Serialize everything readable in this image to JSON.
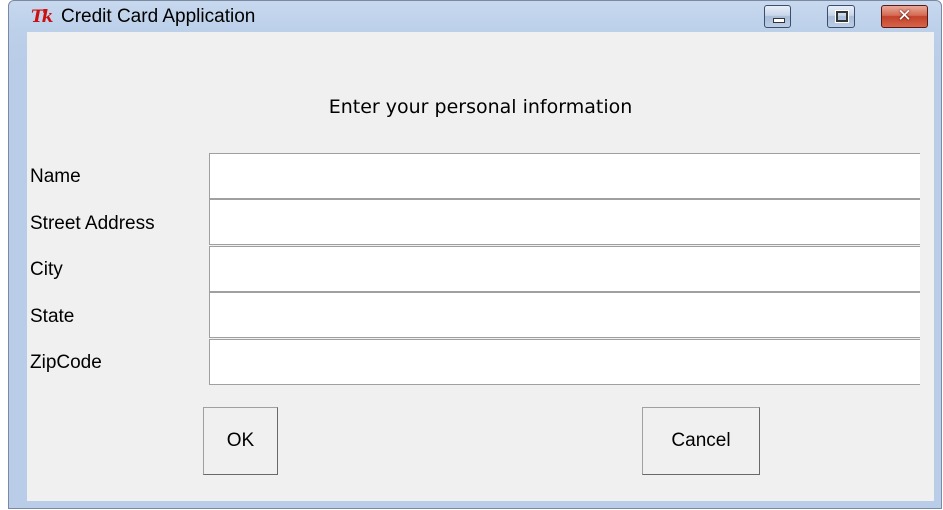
{
  "window": {
    "title": "Credit Card Application",
    "icon": "tk-feather-icon",
    "controls": {
      "minimize": "minimize-icon",
      "maximize": "maximize-icon",
      "close": "close-icon",
      "close_glyph": "✕"
    }
  },
  "form": {
    "heading": "Enter your personal information",
    "fields": [
      {
        "label": "Name",
        "value": ""
      },
      {
        "label": "Street Address",
        "value": ""
      },
      {
        "label": "City",
        "value": ""
      },
      {
        "label": "State",
        "value": ""
      },
      {
        "label": "ZipCode",
        "value": ""
      }
    ]
  },
  "buttons": {
    "ok": "OK",
    "cancel": "Cancel"
  },
  "colors": {
    "frame": "#b9cde8",
    "client": "#f0f0f0",
    "close_button": "#c2412a",
    "icon_red": "#cc1010"
  }
}
